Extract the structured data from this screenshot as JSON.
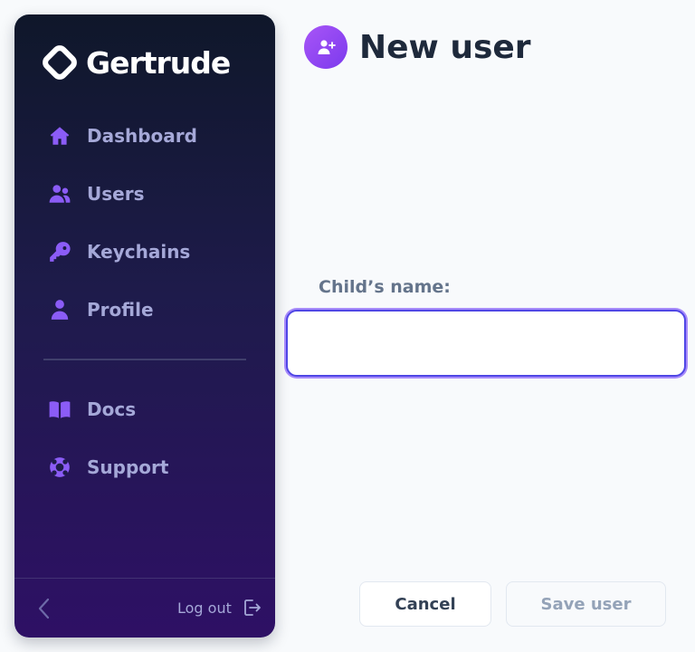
{
  "app": {
    "name": "Gertrude"
  },
  "sidebar": {
    "items": [
      {
        "label": "Dashboard",
        "icon": "home-icon"
      },
      {
        "label": "Users",
        "icon": "users-icon"
      },
      {
        "label": "Keychains",
        "icon": "key-icon"
      },
      {
        "label": "Profile",
        "icon": "user-icon"
      },
      {
        "label": "Docs",
        "icon": "book-icon"
      },
      {
        "label": "Support",
        "icon": "lifebuoy-icon"
      }
    ],
    "footer": {
      "collapse_icon": "chevron-left-icon",
      "logout_label": "Log out",
      "logout_icon": "logout-icon"
    }
  },
  "header": {
    "title": "New user",
    "icon": "user-plus-icon"
  },
  "form": {
    "name_label": "Child’s name:",
    "name_value": "",
    "name_placeholder": ""
  },
  "actions": {
    "cancel_label": "Cancel",
    "save_label": "Save user",
    "save_disabled": true
  },
  "colors": {
    "accent": "#8b5cf6",
    "sidebar_text": "#a5a8d8",
    "title": "#1e293b",
    "input_focus": "#4f46e5"
  }
}
